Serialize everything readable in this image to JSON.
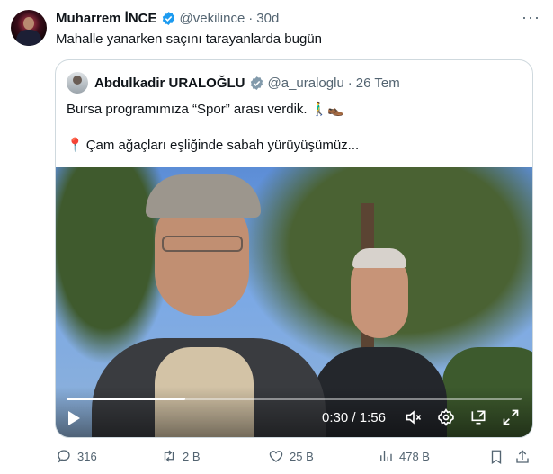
{
  "tweet": {
    "author_name": "Muharrem İNCE",
    "handle": "@vekilince",
    "separator": "·",
    "time": "30d",
    "text": "Mahalle yanarken saçını tarayanlarda bugün",
    "more_label": "···",
    "verified_color": "#1d9bf0"
  },
  "quote": {
    "author_name": "Abdulkadir URALOĞLU",
    "handle": "@a_uraloglu",
    "separator": "·",
    "time": "26 Tem",
    "line1": "Bursa programımıza “Spor” arası verdik. 🚶‍♂️👞",
    "line2_pin": "📍",
    "line2": "Çam ağaçları eşliğinde sabah yürüyüşümüz...",
    "verified_color": "#829aab"
  },
  "video": {
    "current_time": "0:30",
    "time_separator": "/",
    "duration": "1:56",
    "progress_fraction": 0.26,
    "controls": [
      "play-icon",
      "mute-icon",
      "settings-icon",
      "pip-icon",
      "fullscreen-icon"
    ]
  },
  "actions": {
    "replies": "316",
    "reposts": "2 B",
    "likes": "25 B",
    "views": "478 B"
  },
  "colors": {
    "muted": "#536471",
    "border": "#cfd9de"
  }
}
